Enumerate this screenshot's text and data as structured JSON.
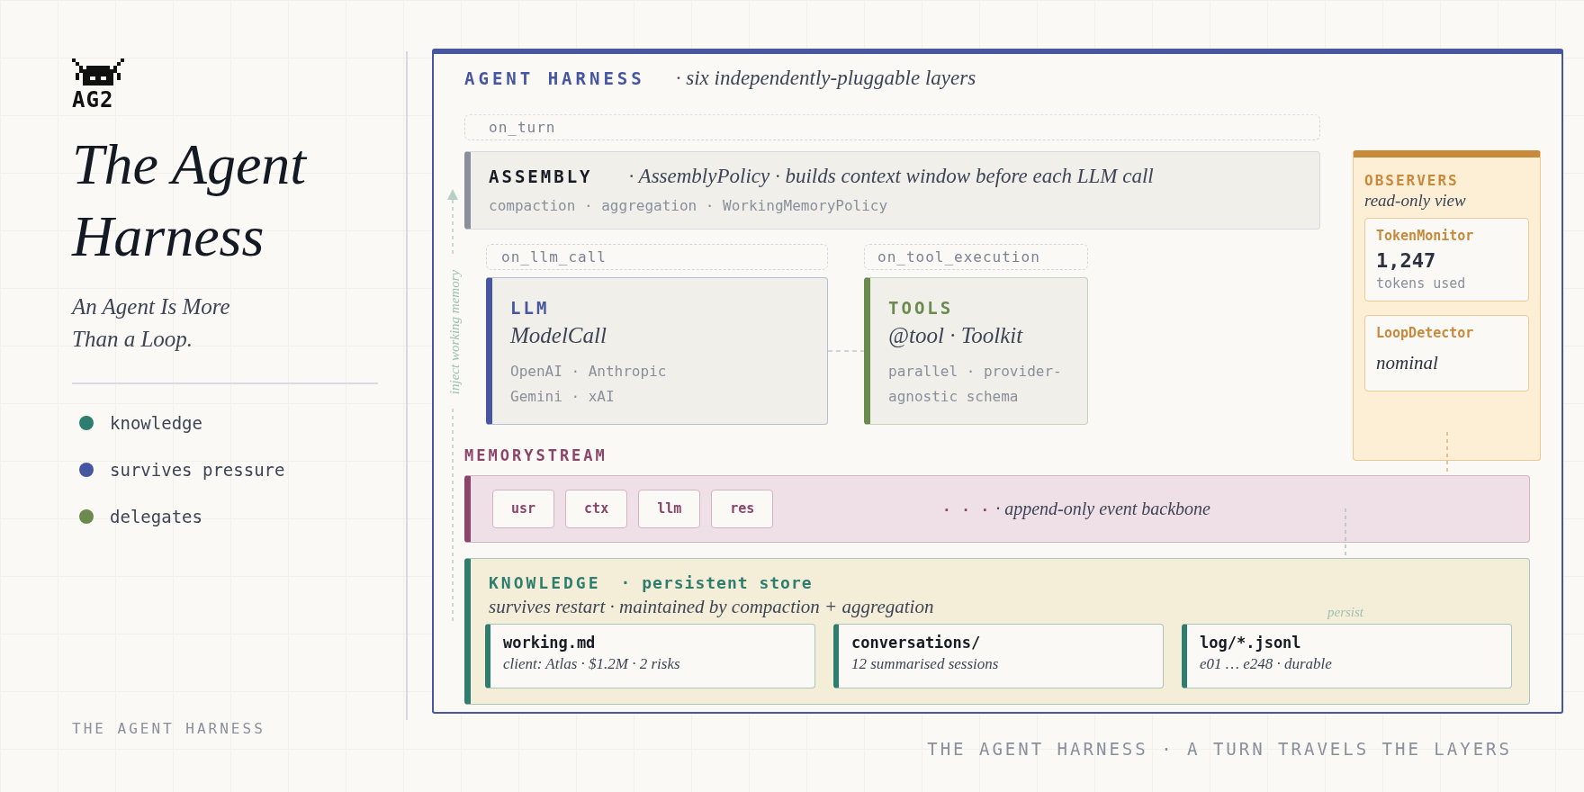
{
  "sidebar": {
    "logo_text": "AG2",
    "title": "The Agent Harness",
    "subtitle": "An Agent Is More Than a Loop.",
    "legend": [
      {
        "label": "knowledge",
        "color": "#2f7d6e"
      },
      {
        "label": "survives pressure",
        "color": "#4656a0"
      },
      {
        "label": "delegates",
        "color": "#6b8a4e"
      }
    ],
    "footer": "THE AGENT HARNESS"
  },
  "harness": {
    "title": "AGENT HARNESS",
    "tagline": "· six independently-pluggable layers",
    "assembly": {
      "hook": "on_turn",
      "title": "ASSEMBLY",
      "description": "· AssemblyPolicy · builds context window before each LLM call",
      "details": "compaction · aggregation · WorkingMemoryPolicy"
    },
    "llm": {
      "hook": "on_llm_call",
      "title": "LLM",
      "subtitle": "ModelCall",
      "details": [
        "OpenAI · Anthropic",
        "Gemini · xAI"
      ]
    },
    "tools": {
      "hook": "on_tool_execution",
      "title": "TOOLS",
      "subtitle": "@tool · Toolkit",
      "details": [
        "parallel · provider-agnostic schema"
      ]
    },
    "observers": {
      "title": "OBSERVERS",
      "subtitle": "read-only view",
      "monitors": [
        {
          "kind": "metric",
          "name": "TokenMonitor",
          "value": "1,247",
          "caption": "tokens used"
        },
        {
          "kind": "status",
          "name": "LoopDetector",
          "value": "nominal"
        }
      ]
    },
    "memory_stream": {
      "title": "MEMORYSTREAM",
      "events": [
        "usr",
        "ctx",
        "llm",
        "res"
      ],
      "ellipsis": "· · ·",
      "description": "· append-only event backbone"
    },
    "knowledge": {
      "title": "KNOWLEDGE",
      "tagline": "· persistent store",
      "subtitle": "survives restart · maintained by compaction + aggregation",
      "files": [
        {
          "name": "working.md",
          "description": "client: Atlas · $1.2M · 2 risks"
        },
        {
          "name": "conversations/",
          "description": "12 summarised sessions"
        },
        {
          "name": "log/*.jsonl",
          "description": "e01 … e248 · durable"
        }
      ]
    },
    "inject_label": "inject working memory",
    "persist_label": "persist"
  },
  "footer": "THE AGENT HARNESS · A TURN TRAVELS THE LAYERS"
}
